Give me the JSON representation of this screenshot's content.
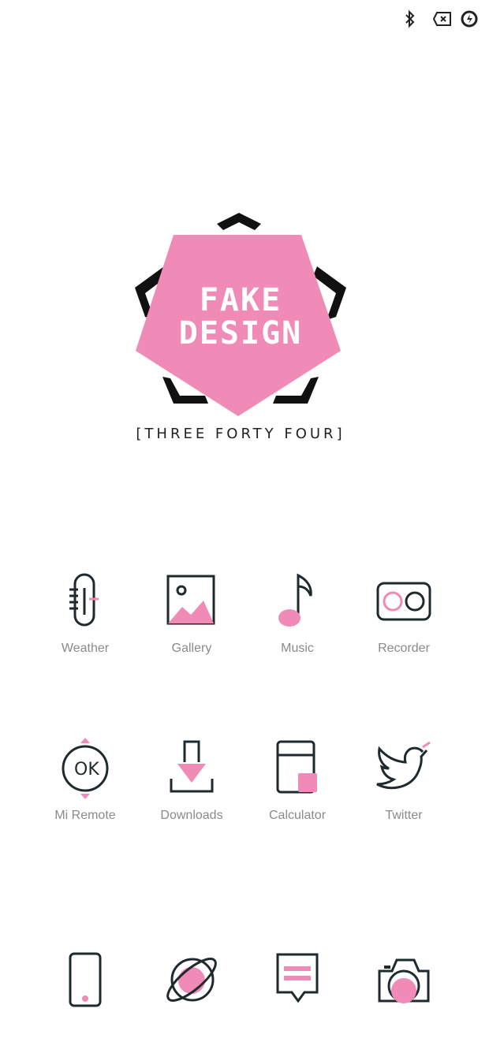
{
  "status_bar": {
    "icons": [
      "bluetooth-icon",
      "battery-saver-icon",
      "charging-icon"
    ]
  },
  "wallpaper_logo": {
    "line1": "FAKE",
    "line2": "DESIGN",
    "tagline": "[THREE FORTY FOUR]",
    "accent_color": "#F08AB6",
    "frame_color": "#111111"
  },
  "apps": [
    {
      "label": "Weather",
      "icon": "thermometer-icon"
    },
    {
      "label": "Gallery",
      "icon": "image-icon"
    },
    {
      "label": "Music",
      "icon": "music-note-icon"
    },
    {
      "label": "Recorder",
      "icon": "recorder-icon"
    },
    {
      "label": "Mi Remote",
      "icon": "remote-ok-icon"
    },
    {
      "label": "Downloads",
      "icon": "download-icon"
    },
    {
      "label": "Calculator",
      "icon": "calculator-icon"
    },
    {
      "label": "Twitter",
      "icon": "bird-icon"
    }
  ],
  "dock": [
    {
      "icon": "phone-icon"
    },
    {
      "icon": "browser-planet-icon"
    },
    {
      "icon": "message-icon"
    },
    {
      "icon": "camera-icon"
    }
  ],
  "colors": {
    "accent": "#F08AB6",
    "line": "#1f2a2e",
    "label": "#8a8a8a",
    "background": "#FFFFFF"
  }
}
